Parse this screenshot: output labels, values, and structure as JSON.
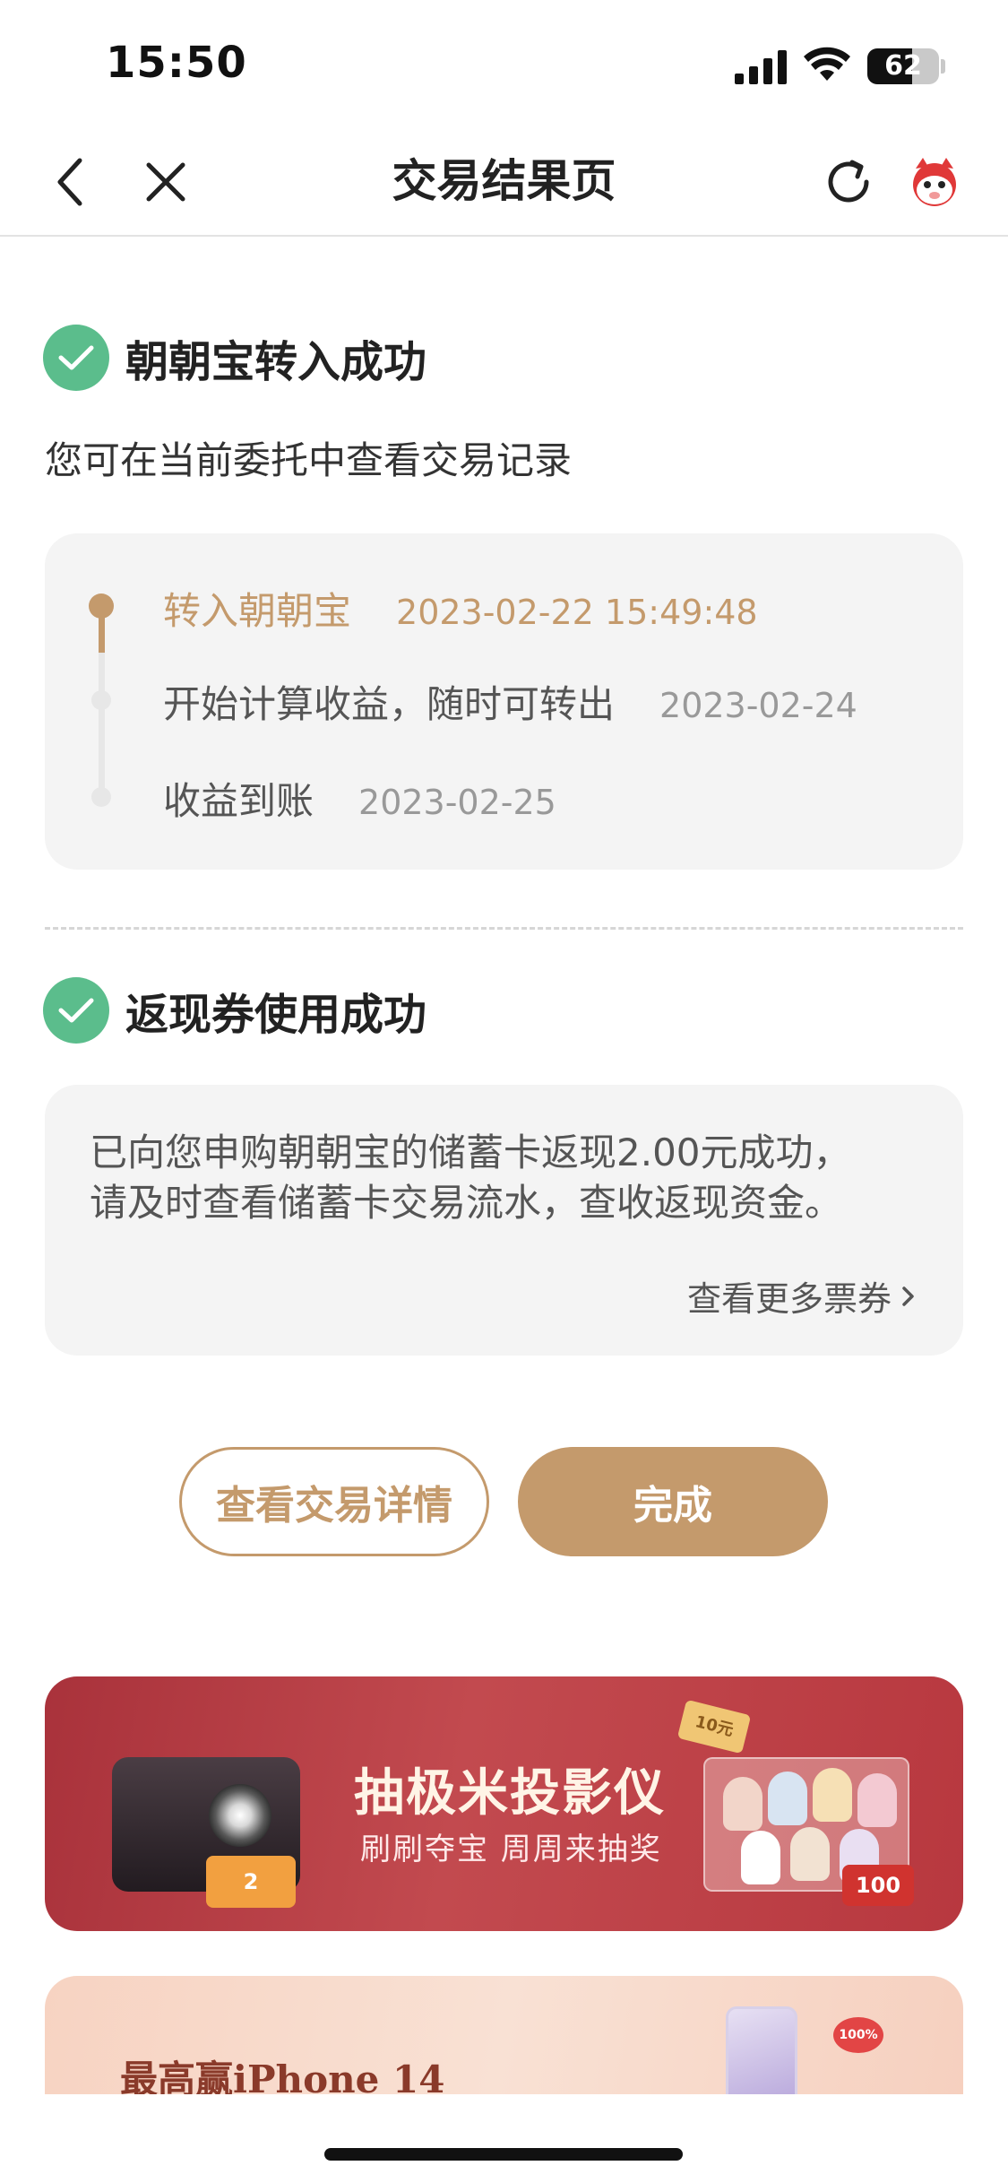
{
  "status_bar": {
    "time": "15:50",
    "battery": "62",
    "battery_level": 0.62
  },
  "nav": {
    "title": "交易结果页",
    "icons": [
      "back-icon",
      "close-icon",
      "refresh-icon",
      "mascot-icon"
    ]
  },
  "transfer": {
    "title": "朝朝宝转入成功",
    "subtitle": "您可在当前委托中查看交易记录",
    "steps": [
      {
        "label": "转入朝朝宝",
        "date": "2023-02-22 15:49:48",
        "active": true
      },
      {
        "label": "开始计算收益，随时可转出",
        "date": "2023-02-24",
        "active": false
      },
      {
        "label": "收益到账",
        "date": "2023-02-25",
        "active": false
      }
    ]
  },
  "cashback": {
    "title": "返现券使用成功",
    "line1": "已向您申购朝朝宝的储蓄卡返现2.00元成功，",
    "line2": "请及时查看储蓄卡交易流水，查收返现资金。",
    "more_link": "查看更多票券"
  },
  "buttons": {
    "details": "查看交易详情",
    "done": "完成"
  },
  "banner1": {
    "title": "抽极米投影仪",
    "subtitle": "刷刷夺宝 周周来抽奖",
    "card_value": "2",
    "badge": "100",
    "tag": "10元"
  },
  "banner2": {
    "title": "最高赢iPhone 14",
    "badge": "100%"
  },
  "colors": {
    "accent": "#c49a6c",
    "success": "#5bbd8c",
    "banner_red": "#b8383f"
  }
}
